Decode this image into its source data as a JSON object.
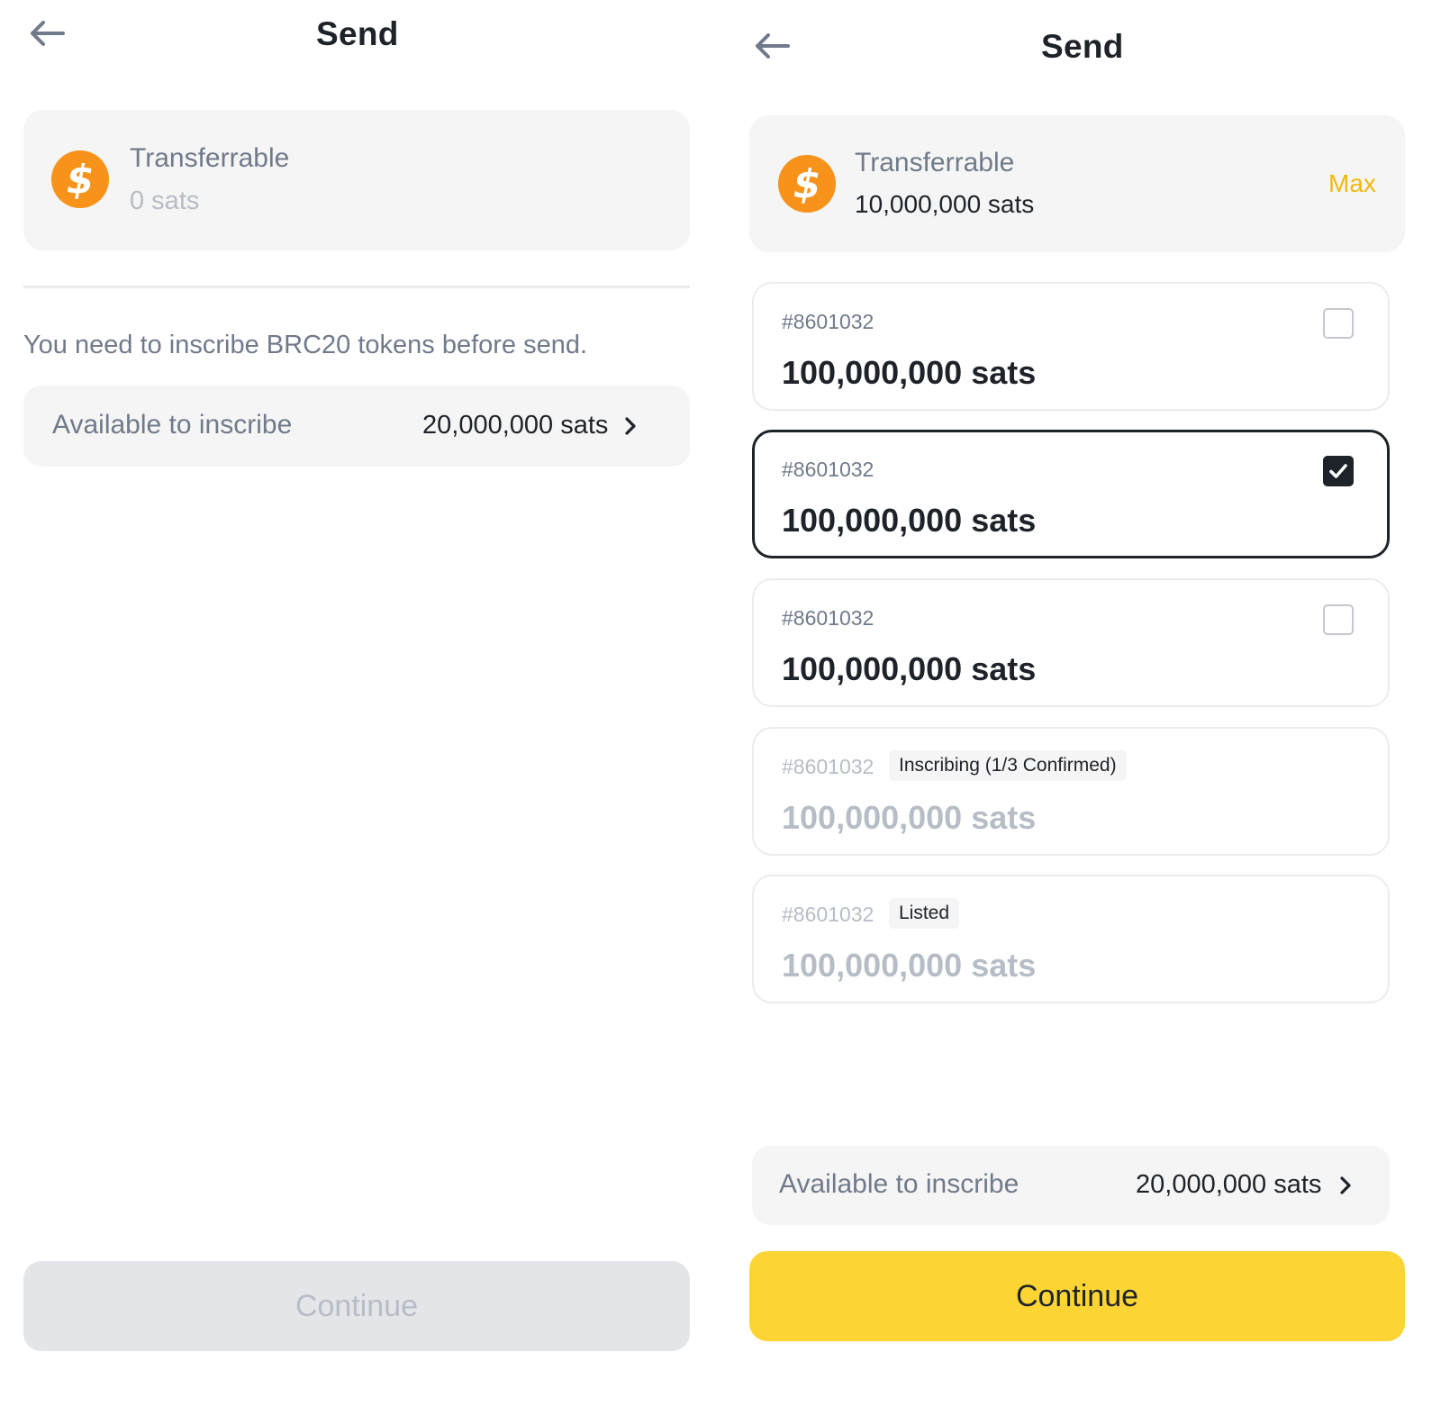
{
  "left": {
    "title": "Send",
    "balance": {
      "label": "Transferrable",
      "value": "0 sats"
    },
    "notice": "You need to inscribe BRC20 tokens before send.",
    "available": {
      "label": "Available to inscribe",
      "value": "20,000,000 sats"
    },
    "continue_label": "Continue"
  },
  "right": {
    "title": "Send",
    "balance": {
      "label": "Transferrable",
      "value": "10,000,000 sats",
      "max_label": "Max"
    },
    "items": [
      {
        "id": "#8601032",
        "amount": "100,000,000 sats",
        "checked": false
      },
      {
        "id": "#8601032",
        "amount": "100,000,000 sats",
        "checked": true
      },
      {
        "id": "#8601032",
        "amount": "100,000,000 sats",
        "checked": false
      },
      {
        "id": "#8601032",
        "amount": "100,000,000 sats",
        "tag": "Inscribing (1/3 Confirmed)"
      },
      {
        "id": "#8601032",
        "amount": "100,000,000 sats",
        "tag": "Listed"
      }
    ],
    "available": {
      "label": "Available to inscribe",
      "value": "20,000,000 sats"
    },
    "continue_label": "Continue"
  },
  "colors": {
    "accent": "#fcd535",
    "max": "#f0b90b",
    "coin": "#f7931a",
    "text": "#1e2329",
    "muted": "#707a8a"
  },
  "icons": [
    "back-arrow-icon",
    "dollar-coin-icon",
    "chevron-right-icon",
    "checkbox-icon",
    "checkmark-icon"
  ]
}
